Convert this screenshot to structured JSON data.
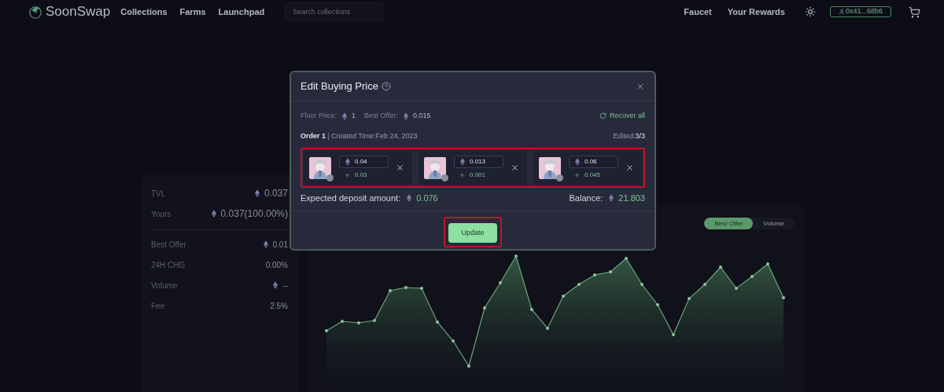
{
  "nav": {
    "logo": "SoonSwap",
    "links": [
      "Collections",
      "Farms",
      "Launchpad"
    ],
    "search": {
      "placeholder": "Search collections"
    },
    "right_links": [
      "Faucet",
      "Your Rewards"
    ],
    "wallet": "0x41...68b6"
  },
  "stats": {
    "summary": [
      {
        "label": "TVL",
        "value": "0.037",
        "kind": "eth"
      },
      {
        "label": "Yours",
        "value": "0.037(100.00%)",
        "kind": "eth"
      }
    ],
    "metrics": [
      {
        "label": "Best Offer",
        "value": "0.01",
        "kind": "eth"
      },
      {
        "label": "24H CHG",
        "value": "0.00%",
        "kind": "plain"
      },
      {
        "label": "Volume",
        "value": "--",
        "kind": "eth"
      },
      {
        "label": "Fee",
        "value": "2.5%",
        "kind": "plain"
      }
    ]
  },
  "chart": {
    "toggle": [
      {
        "label": "Best Offer",
        "selected": true
      },
      {
        "label": "Volume",
        "selected": false
      }
    ]
  },
  "modal": {
    "title": "Edit Buying Price",
    "floor_label": "Floor Price:",
    "floor_value": "1",
    "offer_label": "Best Offer:",
    "offer_value": "0.015",
    "recover": "Recover all",
    "order": "Order 1",
    "created": "Created Time:Feb 24, 2023",
    "edited_label": "Edited:",
    "edited_value": "3/3",
    "items": [
      {
        "price": "0.04",
        "change": "0.03"
      },
      {
        "price": "0.013",
        "change": "0.001"
      },
      {
        "price": "0.06",
        "change": "0.045"
      }
    ],
    "deposit_label": "Expected deposit amount:",
    "deposit_value": "0.076",
    "balance_label": "Balance:",
    "balance_value": "21.803",
    "button": "Update"
  }
}
